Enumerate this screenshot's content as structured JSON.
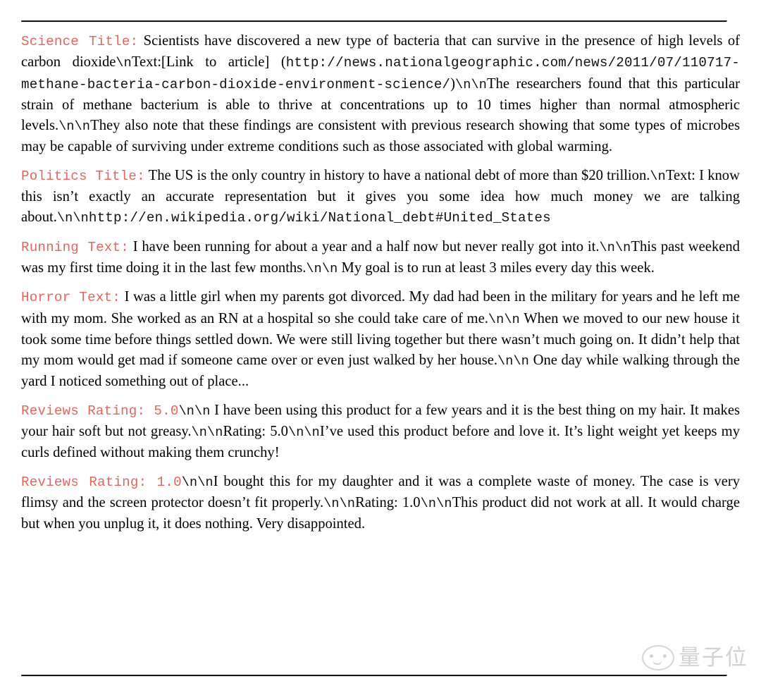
{
  "document": {
    "kind": "latex-table-of-generated-samples",
    "background_color": "#ffffff",
    "rule_color": "#141414",
    "label_color": "#E4655E",
    "body_color": "#000000"
  },
  "rules": {
    "top": "",
    "bottom": ""
  },
  "samples": [
    {
      "id": "science",
      "label": "Science Title:",
      "parts": [
        {
          "style": "serif",
          "text": " Scientists have discovered a new type of bacteria that can survive in the presence of high levels of carbon dioxide"
        },
        {
          "style": "escape",
          "text": "\\n"
        },
        {
          "style": "serif",
          "text": "Text:[Link to article] ("
        },
        {
          "style": "mono",
          "text": "http://news.nationalgeographic.com/news/2011/07/110717-methane-bacteria-carbon-dioxide-environment-science/"
        },
        {
          "style": "serif",
          "text": ")"
        },
        {
          "style": "escape",
          "text": "\\n\\n"
        },
        {
          "style": "serif",
          "text": "The researchers found that this particular strain of methane bacterium is able to thrive at concentrations up to 10 times higher than normal atmospheric levels."
        },
        {
          "style": "escape",
          "text": "\\n\\n"
        },
        {
          "style": "serif",
          "text": "They also note that these findings are consistent with previous research showing that some types of microbes may be capable of surviving under extreme conditions such as those associated with global warming."
        }
      ]
    },
    {
      "id": "politics",
      "label": "Politics Title:",
      "parts": [
        {
          "style": "serif",
          "text": " The US is the only country in history to have a national debt of more than $20 trillion."
        },
        {
          "style": "escape",
          "text": "\\n"
        },
        {
          "style": "serif",
          "text": "Text: I know this isn’t exactly an accurate representation but it gives you some idea how much money we are talking about."
        },
        {
          "style": "escape",
          "text": "\\n\\n"
        },
        {
          "style": "mono",
          "text": "http://en.wikipedia.org/wiki/National_debt#United_States"
        }
      ]
    },
    {
      "id": "running",
      "label": "Running Text:",
      "parts": [
        {
          "style": "serif",
          "text": " I have been running for about a year and a half now but never really got into it."
        },
        {
          "style": "escape",
          "text": "\\n\\n"
        },
        {
          "style": "serif",
          "text": "This past weekend was my first time doing it in the last few months."
        },
        {
          "style": "escape",
          "text": "\\n\\n"
        },
        {
          "style": "serif",
          "text": " My goal is to run at least 3 miles every day this week."
        }
      ]
    },
    {
      "id": "horror",
      "label": "Horror Text:",
      "parts": [
        {
          "style": "serif",
          "text": " I was a little girl when my parents got divorced. My dad had been in the military for years and he left me with my mom. She worked as an RN at a hospital so she could take care of me."
        },
        {
          "style": "escape",
          "text": "\\n\\n"
        },
        {
          "style": "serif",
          "text": " When we moved to our new house it took some time before things settled down. We were still living together but there wasn’t much going on. It didn’t help that my mom would get mad if someone came over or even just walked by her house."
        },
        {
          "style": "escape",
          "text": "\\n\\n"
        },
        {
          "style": "serif",
          "text": " One day while walking through the yard I noticed something out of place..."
        }
      ]
    },
    {
      "id": "reviews-5",
      "label": "Reviews Rating: 5.0",
      "parts": [
        {
          "style": "escape",
          "text": "\\n\\n"
        },
        {
          "style": "serif",
          "text": " I have been using this product for a few years and it is the best thing on my hair. It makes your hair soft but not greasy."
        },
        {
          "style": "escape",
          "text": "\\n\\n"
        },
        {
          "style": "serif",
          "text": "Rating: 5.0"
        },
        {
          "style": "escape",
          "text": "\\n\\n"
        },
        {
          "style": "serif",
          "text": "I’ve used this product before and love it. It’s light weight yet keeps my curls defined without making them crunchy!"
        }
      ]
    },
    {
      "id": "reviews-1",
      "label": "Reviews Rating: 1.0",
      "parts": [
        {
          "style": "escape",
          "text": "\\n\\n"
        },
        {
          "style": "serif",
          "text": "I bought this for my daughter and it was a complete waste of money. The case is very flimsy and the screen protector doesn’t fit properly."
        },
        {
          "style": "escape",
          "text": "\\n\\n"
        },
        {
          "style": "serif",
          "text": "Rating: 1.0"
        },
        {
          "style": "escape",
          "text": "\\n\\n"
        },
        {
          "style": "serif",
          "text": "This product did not work at all. It would charge but when you unplug it, it does nothing. Very disappointed."
        }
      ]
    }
  ],
  "watermark": {
    "icon": "smiley-face-icon",
    "text": "量子位",
    "color": "#8f8f8f"
  }
}
